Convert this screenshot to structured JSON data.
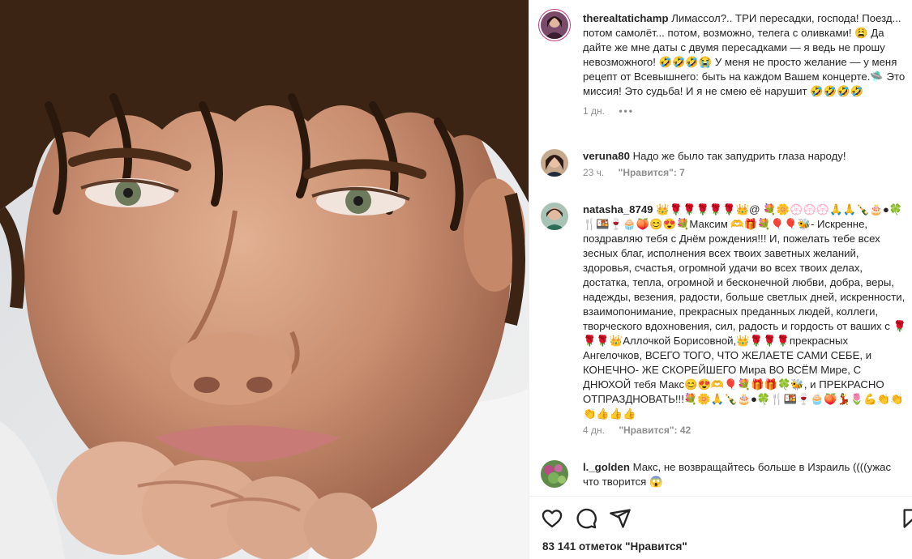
{
  "post": {
    "caption": {
      "username": "therealtatichamp",
      "text": "Лимассол?.. ТРИ пересадки, господа! Поезд... потом самолёт... потом, возможно, телега с оливками! 😩 Да дайте же мне даты с двумя пересадками — я ведь не прошу невозможного! 🤣🤣🤣😭 У меня не просто желание — у меня рецепт от Всевышнего: быть на каждом Вашем концерте.🛸 Это миссия! Это судьба! И я не смею её нарушит 🤣🤣🤣🤣",
      "time": "1 дн.",
      "more": "•••"
    },
    "comments": [
      {
        "username": "veruna80",
        "text": "Надо же было так запудрить глаза народу!",
        "time": "23 ч.",
        "likes": "\"Нравится\": 7"
      },
      {
        "username": "natasha_8749",
        "text": "👑🌹🌹🌹🌹🌹👑@ 💐🌼💮💮💮🙏🙏🍾🎂●🍀🍴🍱🍷🧁🍑😊😍💐Максим 🫶🎁💐🎈🎈🐝- Искренне, поздравляю тебя с Днём рождения!!! И, пожелать тебе всех зесных благ, исполнения всех твоих заветных желаний, здоровья, счастья, огромной удачи во всех твоих делах, достатка, тепла, огромной и бесконечной любви, добра, веры, надежды, везения, радости, больше светлых дней, искренности, взаимопонимание, прекрасных преданных людей, коллеги, творческого вдохновения, сил, радость и гордость от ваших с 🌹🌹🌹👑Аллочкой Борисовной,👑🌹🌹🌹прекрасных Ангелочков, ВСЕГО ТОГО, ЧТО ЖЕЛАЕТЕ САМИ СЕБЕ, и КОНЕЧНО- ЖЕ СКОРЕЙШЕГО Мира ВО ВСЁМ Мире, С ДНЮХОЙ тебя Макс😊😍🫶🎈💐🎁🎁🍀🐝, и ПРЕКРАСНО ОТПРАЗДНОВАТЬ!!!💐🌼🙏🍾🎂●🍀🍴🍱🍷🧁🍑💃🌷💪👏👏👏👍👍👍",
        "time": "4 дн.",
        "likes": "\"Нравится\": 42"
      },
      {
        "username": "l._golden",
        "text": "Макс, не возвращайтесь больше в Израиль ((((ужас что творится 😱",
        "time": "",
        "likes": ""
      }
    ],
    "likes_total": "83 141 отметок \"Нравится\"",
    "icons": [
      "heart-icon",
      "comment-icon",
      "share-icon",
      "bookmark-icon"
    ]
  }
}
